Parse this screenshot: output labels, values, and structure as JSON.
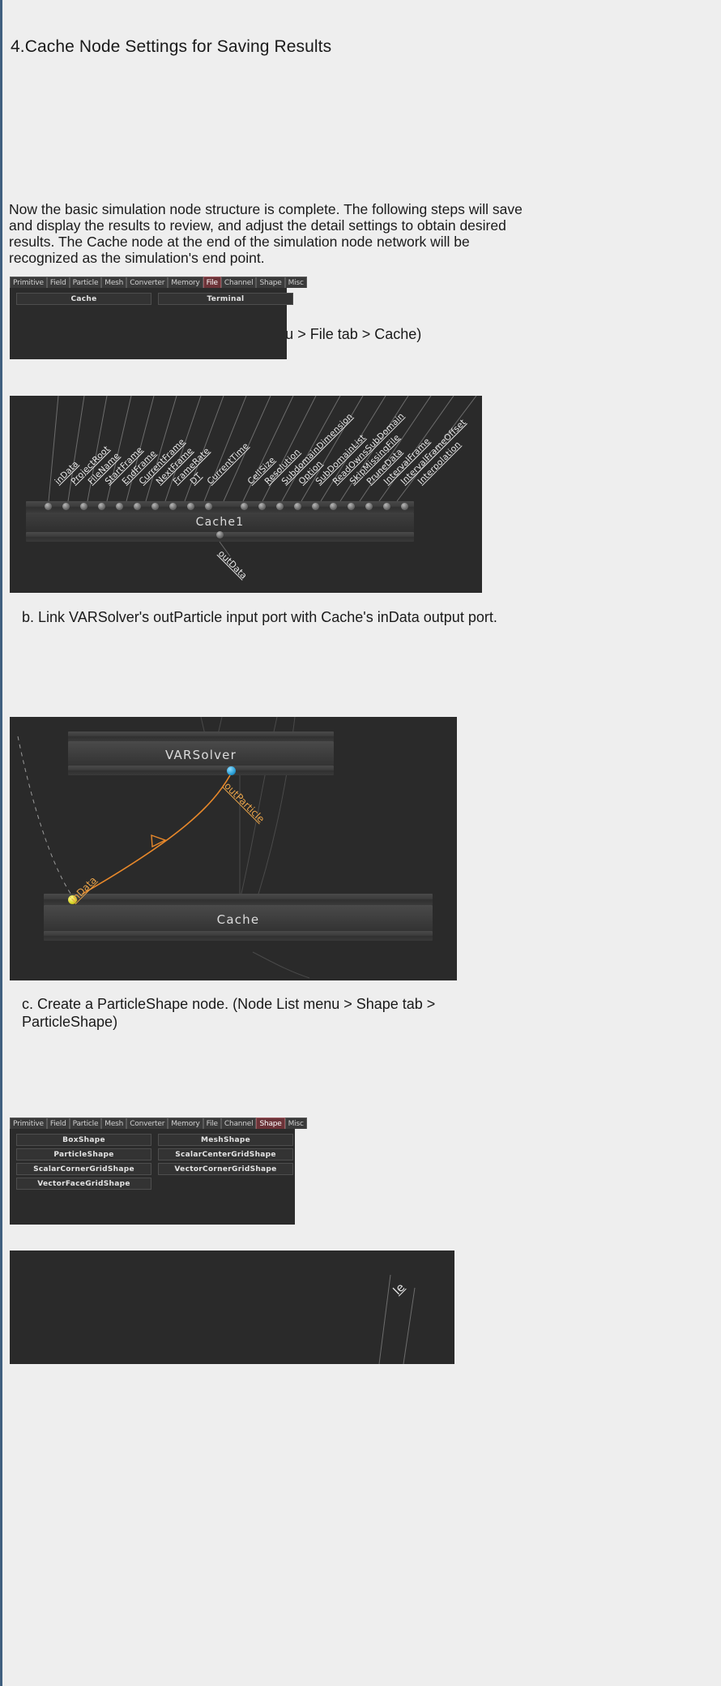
{
  "document": {
    "heading": "4.Cache Node Settings for Saving Results",
    "paragraph": "Now the basic simulation node structure is complete. The following steps will save and display the results to review, and adjust the detail settings to obtain desired results. The Cache node at the end of the simulation node network will be recognized as the simulation's end point.",
    "steps": {
      "a": "a. Create a Cache node. (Node List menu > File tab > Cache)",
      "b": "b. Link VARSolver's outParticle input port with Cache's inData output port.",
      "c": "c. Create a ParticleShape node. (Node List menu > Shape tab > ParticleShape)"
    }
  },
  "node_list_menu_file": {
    "tabs": [
      {
        "label": "Primitive",
        "active": false
      },
      {
        "label": "Field",
        "active": false
      },
      {
        "label": "Particle",
        "active": false
      },
      {
        "label": "Mesh",
        "active": false
      },
      {
        "label": "Converter",
        "active": false
      },
      {
        "label": "Memory",
        "active": false
      },
      {
        "label": "File",
        "active": true
      },
      {
        "label": "Channel",
        "active": false
      },
      {
        "label": "Shape",
        "active": false
      },
      {
        "label": "Misc",
        "active": false
      }
    ],
    "buttons": [
      "Cache",
      "Terminal"
    ]
  },
  "node_list_menu_shape": {
    "tabs": [
      {
        "label": "Primitive",
        "active": false
      },
      {
        "label": "Field",
        "active": false
      },
      {
        "label": "Particle",
        "active": false
      },
      {
        "label": "Mesh",
        "active": false
      },
      {
        "label": "Converter",
        "active": false
      },
      {
        "label": "Memory",
        "active": false
      },
      {
        "label": "File",
        "active": false
      },
      {
        "label": "Channel",
        "active": false
      },
      {
        "label": "Shape",
        "active": true
      },
      {
        "label": "Misc",
        "active": false
      }
    ],
    "buttons": [
      [
        "BoxShape",
        "MeshShape"
      ],
      [
        "ParticleShape",
        "ScalarCenterGridShape"
      ],
      [
        "ScalarCornerGridShape",
        "VectorCornerGridShape"
      ],
      [
        "VectorFaceGridShape",
        ""
      ]
    ]
  },
  "cache_node_graph": {
    "node_title": "Cache1",
    "input_ports": [
      "inData",
      "ProjectRoot",
      "FileName",
      "StartFrame",
      "EndFrame",
      "CurrentFrame",
      "NextFrame",
      "FrameRate",
      "DT",
      "CurrentTime",
      "CellSize",
      "Resolution",
      "SubdomainDimension",
      "Option",
      "SubDomainList",
      "ReadOwnsSubDomain",
      "SkipMissingFile",
      "PruneData",
      "IntervalFrame",
      "IntervalFrameOffset",
      "Interpolation"
    ],
    "output_ports": [
      "outData"
    ]
  },
  "link_graph": {
    "source_node": "VARSolver",
    "source_port": "outParticle",
    "target_node": "Cache",
    "target_port": "inData",
    "wire_color": "#e8882a",
    "source_dot_color": "#2a9fd6",
    "target_dot_color": "#d8d227"
  },
  "particle_shape_graph": {
    "partial_label": "le"
  }
}
